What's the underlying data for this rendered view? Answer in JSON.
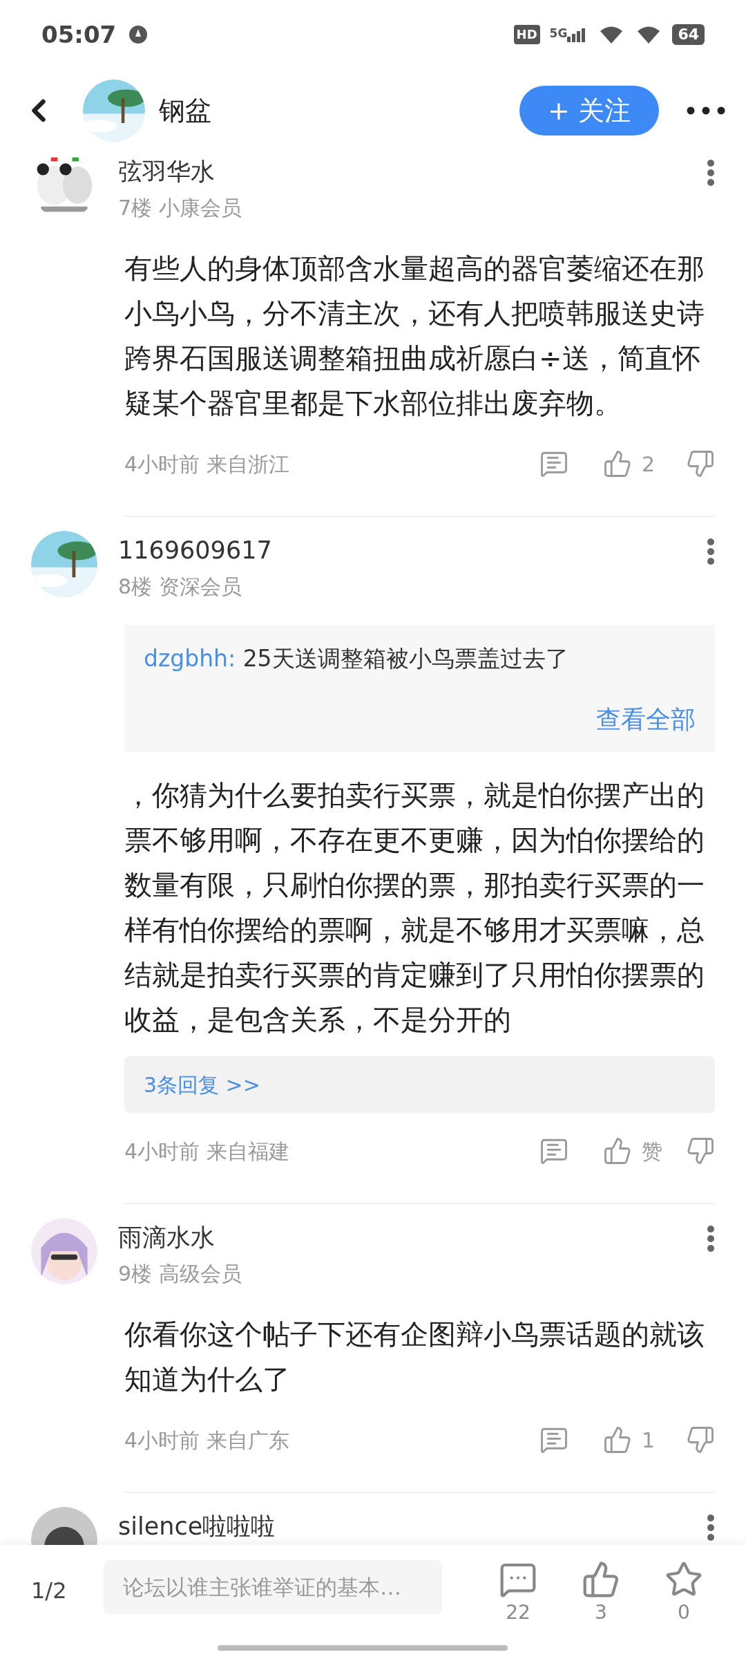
{
  "status_bar": {
    "time": "05:07",
    "hd": "HD",
    "network": "5G",
    "battery": "64"
  },
  "header": {
    "title": "钢盆",
    "follow_button": "+ 关注"
  },
  "comments": [
    {
      "author": "弦羽华水",
      "floor": "7楼",
      "rank": "小康会员",
      "text": "有些人的身体顶部含水量超高的器官萎缩还在那小鸟小鸟，分不清主次，还有人把喷韩服送史诗跨界石国服送调整箱扭曲成祈愿白÷送，简直怀疑某个器官里都是下水部位排出废弃物。",
      "time": "4小时前",
      "location": "来自浙江",
      "likes": "2"
    },
    {
      "author": "1169609617",
      "floor": "8楼",
      "rank": "资深会员",
      "quote": {
        "user": "dzgbhh:",
        "text": "25天送调整箱被小鸟票盖过去了",
        "more": "查看全部"
      },
      "text": "，你猜为什么要拍卖行买票，就是怕你摆产出的票不够用啊，不存在更不更赚，因为怕你摆给的数量有限，只刷怕你摆的票，那拍卖行买票的一样有怕你摆给的票啊，就是不够用才买票嘛，总结就是拍卖行买票的肯定赚到了只用怕你摆票的收益，是包含关系，不是分开的",
      "replies": "3条回复 >>",
      "time": "4小时前",
      "location": "来自福建",
      "likes": "赞"
    },
    {
      "author": "雨滴水水",
      "floor": "9楼",
      "rank": "高级会员",
      "text": "你看你这个帖子下还有企图辩小鸟票话题的就该知道为什么了",
      "time": "4小时前",
      "location": "来自广东",
      "likes": "1"
    },
    {
      "author": "silence啦啦啦"
    }
  ],
  "bottom_bar": {
    "page": "1/2",
    "placeholder": "论坛以谁主张谁举证的基本…",
    "comments": "22",
    "likes": "3",
    "favorites": "0"
  }
}
